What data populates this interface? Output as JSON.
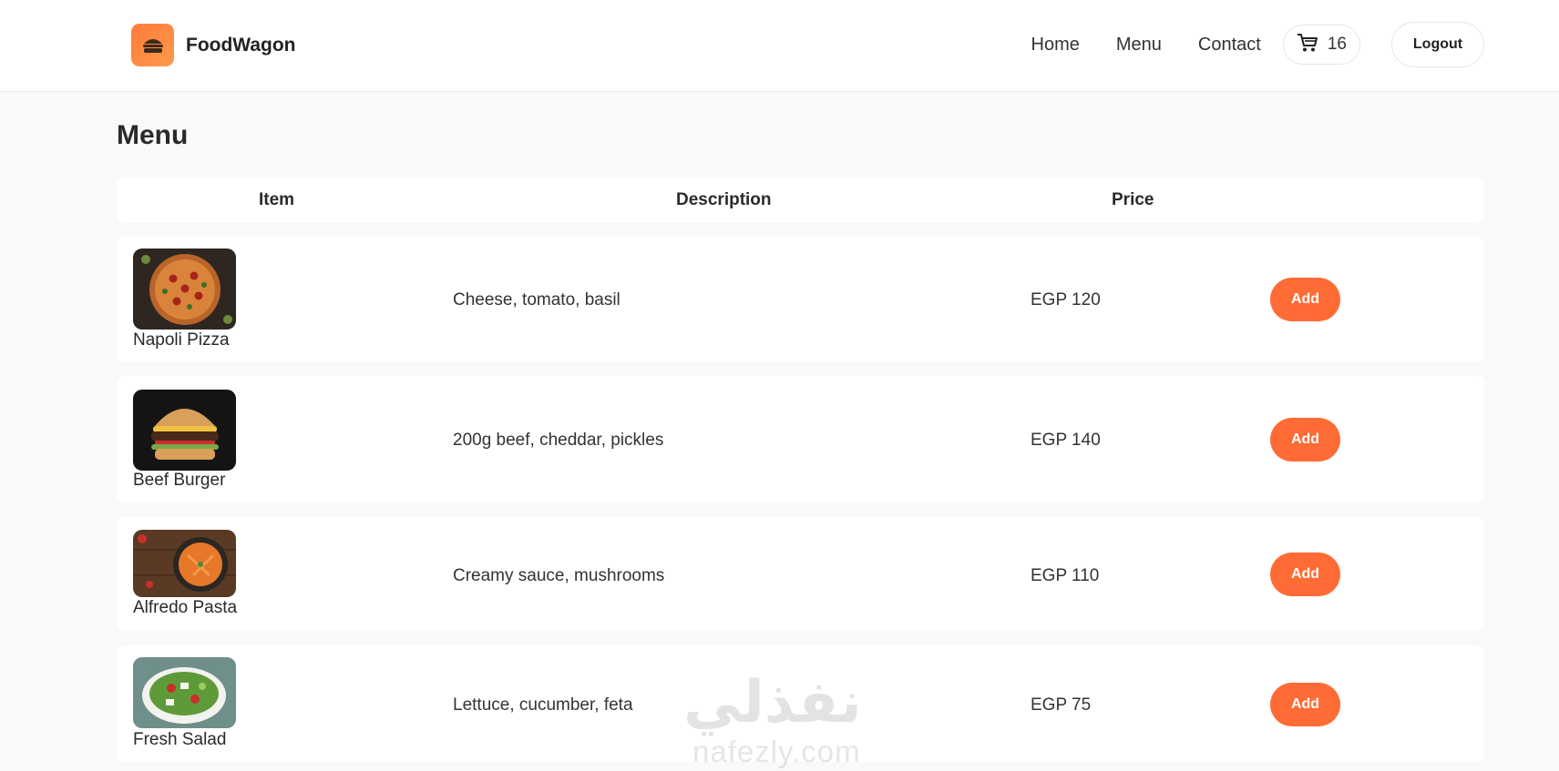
{
  "brand": {
    "name": "FoodWagon",
    "logo_icon": "burger-icon",
    "accent": "#ff6b35"
  },
  "nav": {
    "links": [
      {
        "label": "Home"
      },
      {
        "label": "Menu"
      },
      {
        "label": "Contact"
      }
    ],
    "cart": {
      "icon": "cart-icon",
      "count": "16"
    },
    "logout_label": "Logout"
  },
  "main": {
    "title": "Menu",
    "columns": {
      "item": "Item",
      "description": "Description",
      "price": "Price"
    },
    "items": [
      {
        "name": "Napoli Pizza",
        "description": "Cheese, tomato, basil",
        "price": "EGP 120",
        "add_label": "Add",
        "image": "pizza-image"
      },
      {
        "name": "Beef Burger",
        "description": "200g beef, cheddar, pickles",
        "price": "EGP 140",
        "add_label": "Add",
        "image": "burger-image"
      },
      {
        "name": "Alfredo Pasta",
        "description": "Creamy sauce, mushrooms",
        "price": "EGP 110",
        "add_label": "Add",
        "image": "pasta-image"
      },
      {
        "name": "Fresh Salad",
        "description": "Lettuce, cucumber, feta",
        "price": "EGP 75",
        "add_label": "Add",
        "image": "salad-image"
      }
    ]
  },
  "watermark": {
    "arabic": "نفذلي",
    "latin": "nafezly.com"
  }
}
